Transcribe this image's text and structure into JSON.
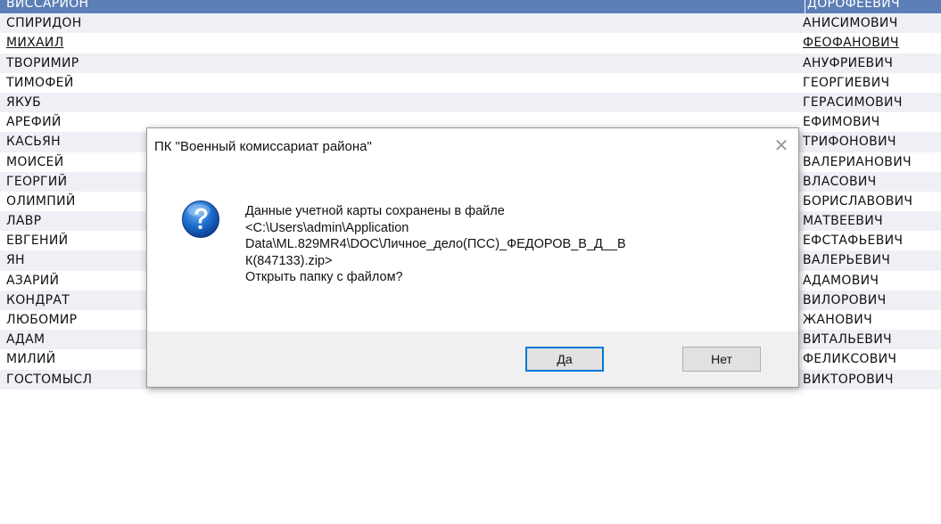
{
  "rows": [
    {
      "first": "ВИССАРИОН",
      "last": "ДОРОФЕЕВИЧ"
    },
    {
      "first": "СПИРИДОН",
      "last": "АНИСИМОВИЧ"
    },
    {
      "first": "МИХАИЛ",
      "last": "ФЕОФАНОВИЧ"
    },
    {
      "first": "ТВОРИМИР",
      "last": "АНУФРИЕВИЧ"
    },
    {
      "first": "ТИМОФЕЙ",
      "last": "ГЕОРГИЕВИЧ"
    },
    {
      "first": "ЯКУБ",
      "last": "ГЕРАСИМОВИЧ"
    },
    {
      "first": "АРЕФИЙ",
      "last": "ЕФИМОВИЧ"
    },
    {
      "first": "КАСЬЯН",
      "last": "ТРИФОНОВИЧ"
    },
    {
      "first": "МОИСЕЙ",
      "last": "ВАЛЕРИАНОВИЧ"
    },
    {
      "first": "ГЕОРГИЙ",
      "last": "ВЛАСОВИЧ"
    },
    {
      "first": "ОЛИМПИЙ",
      "last": "БОРИСЛАВОВИЧ"
    },
    {
      "first": "ЛАВР",
      "last": "МАТВЕЕВИЧ"
    },
    {
      "first": "ЕВГЕНИЙ",
      "last": "ЕФСТАФЬЕВИЧ"
    },
    {
      "first": "ЯН",
      "last": "ВАЛЕРЬЕВИЧ"
    },
    {
      "first": "АЗАРИЙ",
      "last": "АДАМОВИЧ"
    },
    {
      "first": "КОНДРАТ",
      "last": "ВИЛОРОВИЧ"
    },
    {
      "first": "ЛЮБОМИР",
      "last": "ЖАНОВИЧ"
    },
    {
      "first": "АДАМ",
      "last": "ВИТАЛЬЕВИЧ"
    },
    {
      "first": "МИЛИЙ",
      "last": "ФЕЛИКСОВИЧ"
    },
    {
      "first": "ГОСТОМЫСЛ",
      "last": "ВИКТОРОВИЧ"
    }
  ],
  "dialog": {
    "title": "ПК \"Военный комиссариат района\"",
    "close_glyph": "✕",
    "message_lines": [
      "Данные учетной карты сохранены в файле",
      "<C:\\Users\\admin\\Application",
      "Data\\ML.829MR4\\DOC\\Личное_дело(ПСС)_ФЕДОРОВ_В_Д__В",
      "К(847133).zip>",
      "Открыть папку с файлом?"
    ],
    "yes_label": "Да",
    "no_label": "Нет",
    "icon": "question-icon"
  },
  "colors": {
    "selection": "#5c7eb6",
    "accent": "#0078d7"
  }
}
